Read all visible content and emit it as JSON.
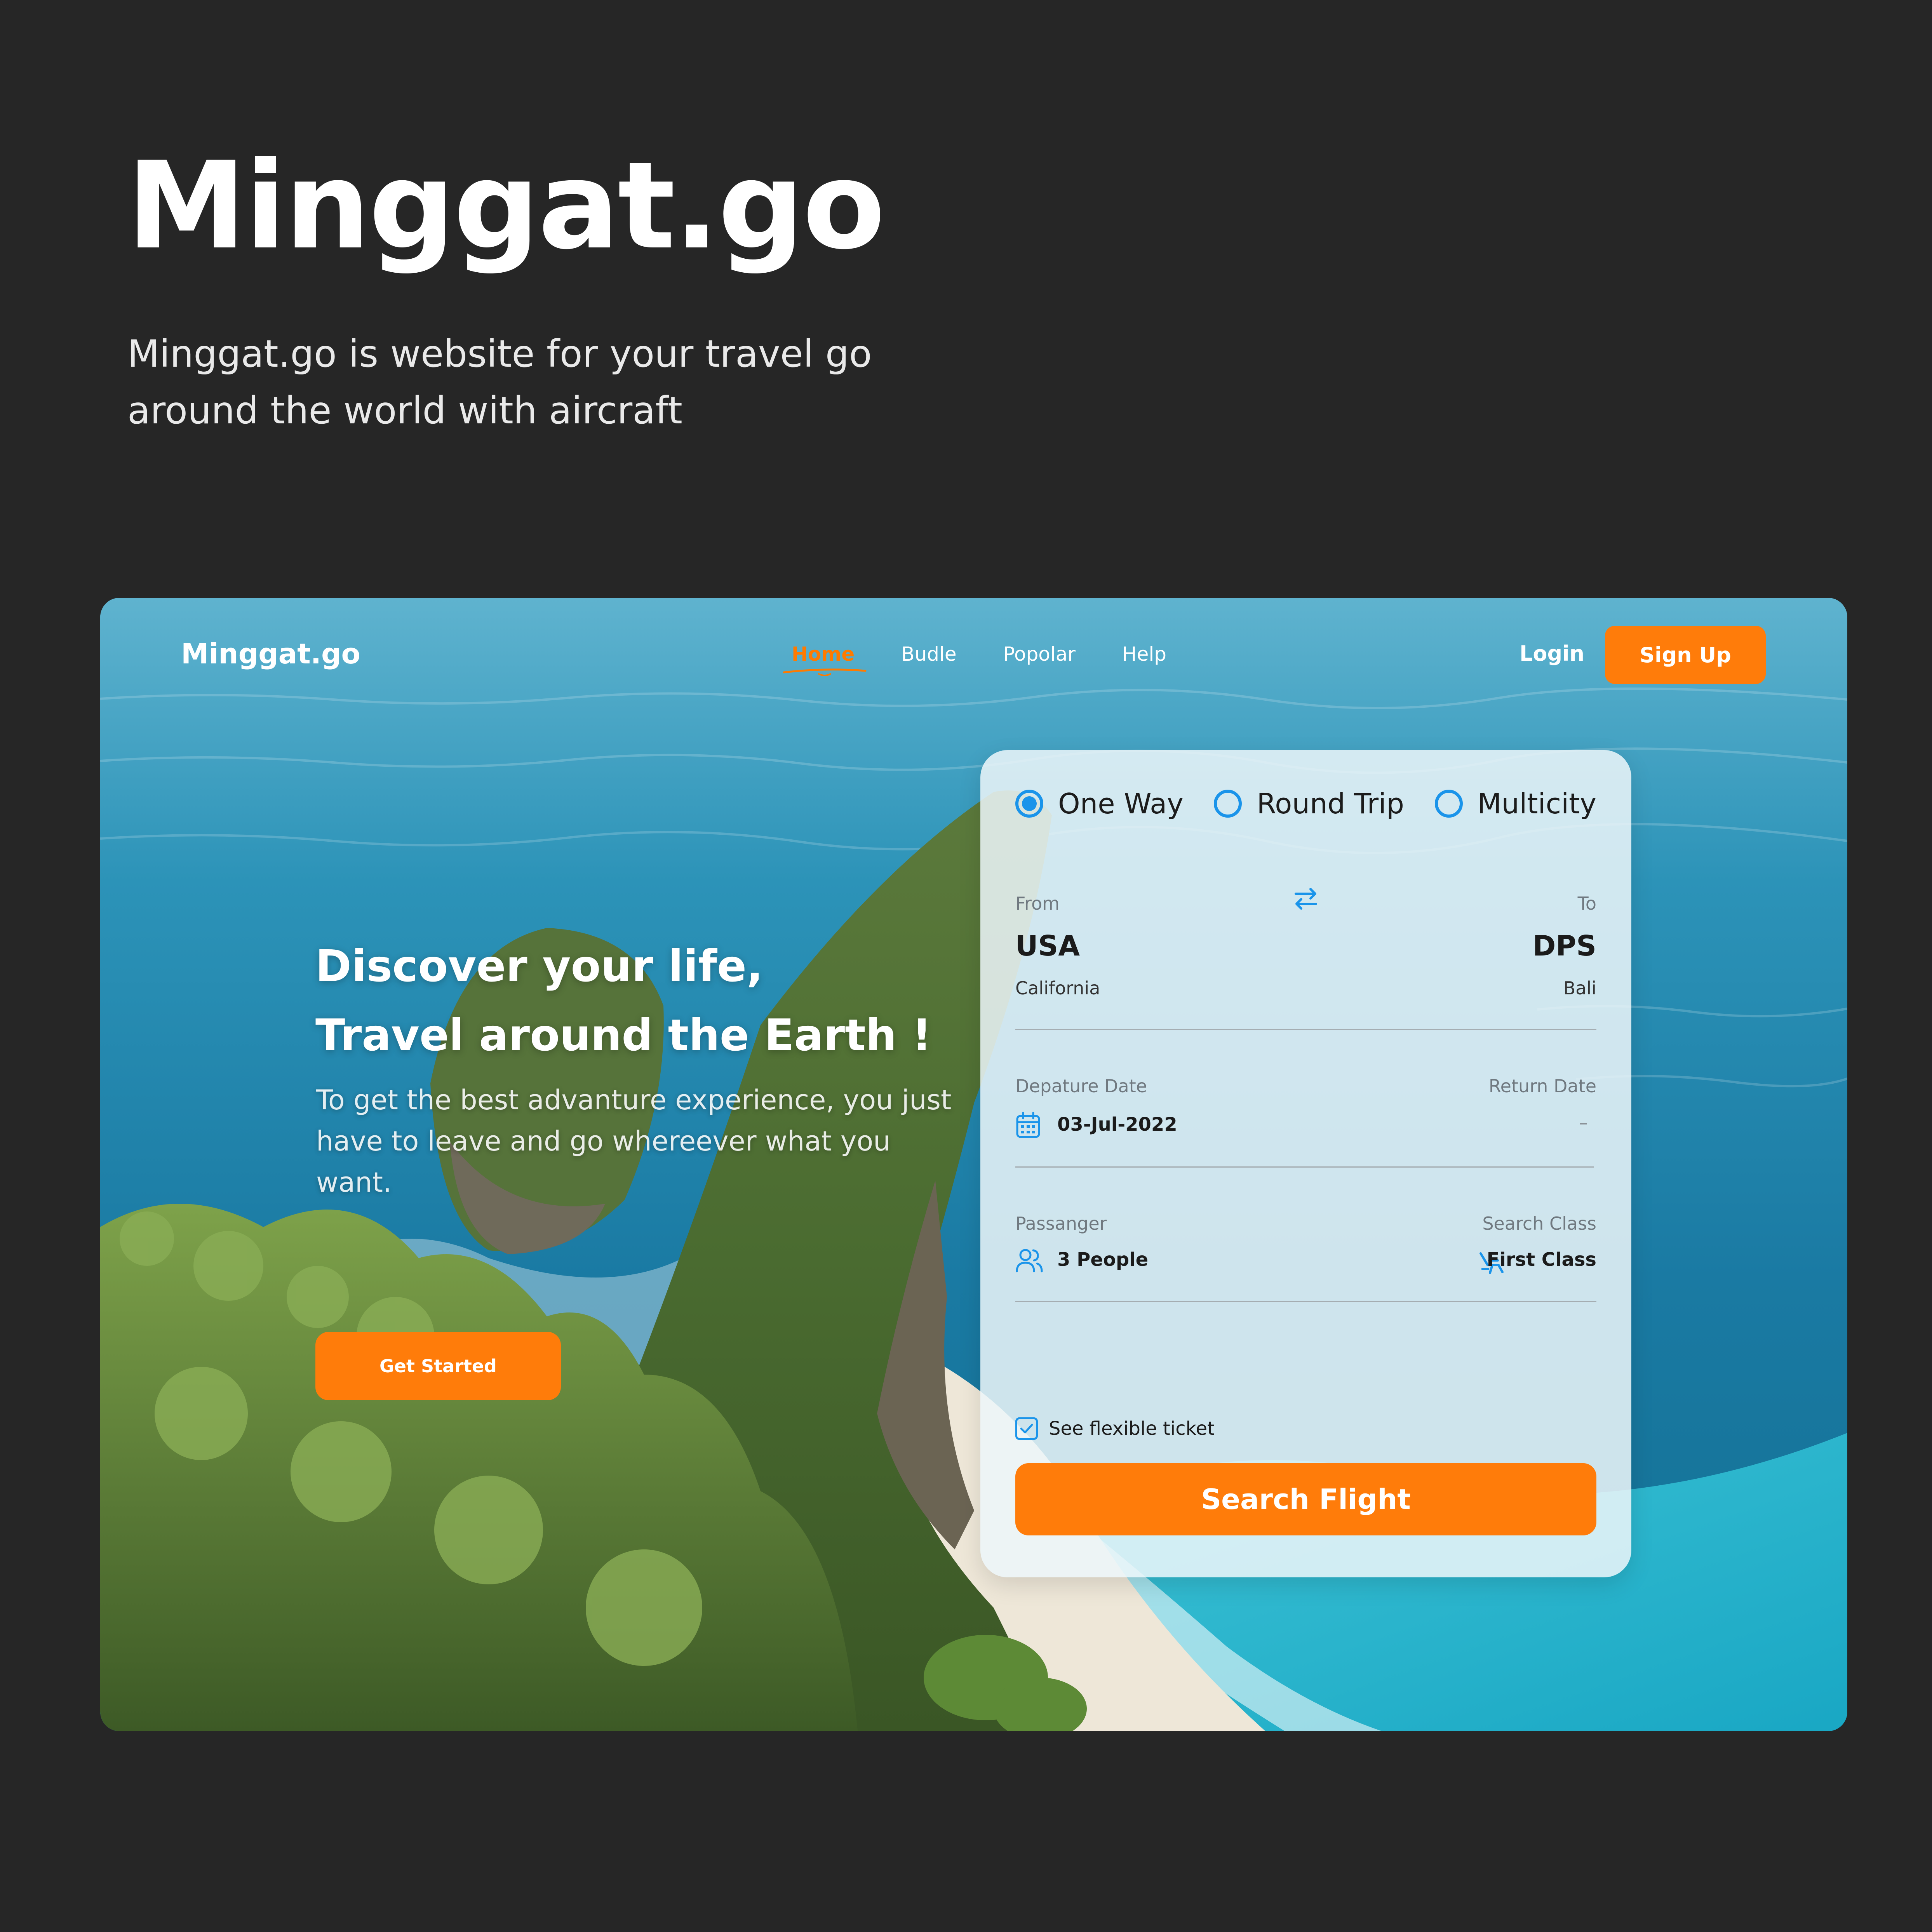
{
  "hero_header": {
    "title": "Minggat.go",
    "description": "Minggat.go is website for your travel go around the world with aircraft"
  },
  "navbar": {
    "logo": "Minggat.go",
    "links": [
      "Home",
      "Budle",
      "Popolar",
      "Help"
    ],
    "active_link": "Home",
    "login_label": "Login",
    "signup_label": "Sign Up"
  },
  "hero": {
    "title_line1": "Discover your life,",
    "title_line2": "Travel around the Earth !",
    "subtitle": "To get the best advanture experience, you just have to leave and go whereever  what you want.",
    "cta_label": "Get Started"
  },
  "booking": {
    "trip_types": [
      "One Way",
      "Round Trip",
      "Multicity"
    ],
    "selected_trip_type": "One Way",
    "from_label": "From",
    "from_code": "USA",
    "from_place": "California",
    "to_label": "To",
    "to_code": "DPS",
    "to_place": "Bali",
    "departure_label": "Depature Date",
    "departure_value": "03-Jul-2022",
    "return_label": "Return Date",
    "return_value": "–",
    "passenger_label": "Passanger",
    "passenger_value": "3 People",
    "class_label": "Search Class",
    "class_value": "First Class",
    "flexible_label": "See flexible ticket",
    "flexible_checked": true,
    "search_label": "Search Flight"
  },
  "colors": {
    "background": "#262626",
    "accent": "#FF7C0A",
    "radio_blue": "#1A94EA"
  }
}
